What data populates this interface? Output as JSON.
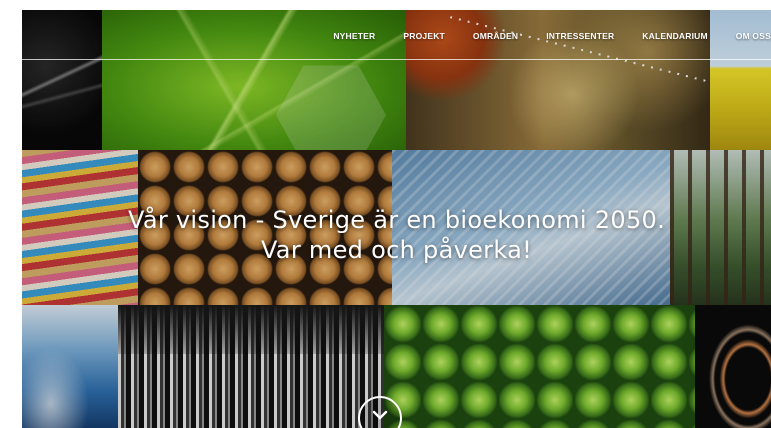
{
  "nav": {
    "items": [
      {
        "label": "NYHETER"
      },
      {
        "label": "PROJEKT"
      },
      {
        "label": "OMRÅDEN"
      },
      {
        "label": "INTRESSENTER"
      },
      {
        "label": "KALENDARIUM"
      },
      {
        "label": "OM OSS"
      }
    ]
  },
  "hero": {
    "headline_line1": "Vår vision - Sverige är en bioekonomi 2050.",
    "headline_line2": "Var med och påverka!",
    "scroll_icon": "chevron-down-icon"
  },
  "colors": {
    "text": "#ffffff",
    "accent_leaf": "#6fb81e"
  }
}
